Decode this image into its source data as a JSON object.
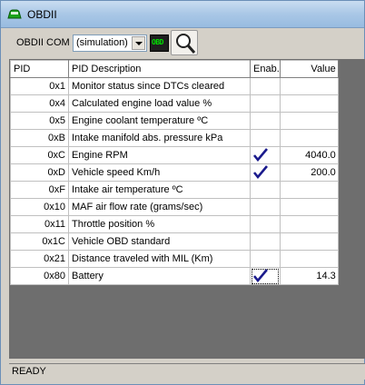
{
  "window": {
    "title": "OBDII"
  },
  "toolbar": {
    "com_label": "OBDII COM",
    "com_selected": "(simulation)",
    "obd_button_label": "OBD"
  },
  "table": {
    "headers": {
      "pid": "PID",
      "desc": "PID Description",
      "enab": "Enab.",
      "value": "Value"
    },
    "rows": [
      {
        "pid": "0x1",
        "desc": "Monitor status since DTCs cleared",
        "enabled": false,
        "value": ""
      },
      {
        "pid": "0x4",
        "desc": "Calculated engine load value %",
        "enabled": false,
        "value": ""
      },
      {
        "pid": "0x5",
        "desc": "Engine coolant temperature ºC",
        "enabled": false,
        "value": ""
      },
      {
        "pid": "0xB",
        "desc": "Intake manifold abs. pressure kPa",
        "enabled": false,
        "value": ""
      },
      {
        "pid": "0xC",
        "desc": "Engine RPM",
        "enabled": true,
        "value": "4040.0"
      },
      {
        "pid": "0xD",
        "desc": "Vehicle speed Km/h",
        "enabled": true,
        "value": "200.0"
      },
      {
        "pid": "0xF",
        "desc": "Intake air temperature ºC",
        "enabled": false,
        "value": ""
      },
      {
        "pid": "0x10",
        "desc": "MAF air flow rate (grams/sec)",
        "enabled": false,
        "value": ""
      },
      {
        "pid": "0x11",
        "desc": "Throttle position %",
        "enabled": false,
        "value": ""
      },
      {
        "pid": "0x1C",
        "desc": "Vehicle OBD standard",
        "enabled": false,
        "value": ""
      },
      {
        "pid": "0x21",
        "desc": "Distance traveled with MIL (Km)",
        "enabled": false,
        "value": ""
      },
      {
        "pid": "0x80",
        "desc": "Battery",
        "enabled": true,
        "value": "14.3"
      }
    ]
  },
  "status": {
    "text": "READY"
  },
  "colors": {
    "check": "#1a1a8c",
    "obd_text": "#00e000",
    "titlebar": "#a9c7e6"
  },
  "icons": {
    "app": "car-icon",
    "zoom": "magnifier-icon",
    "check": "checkmark-icon"
  }
}
